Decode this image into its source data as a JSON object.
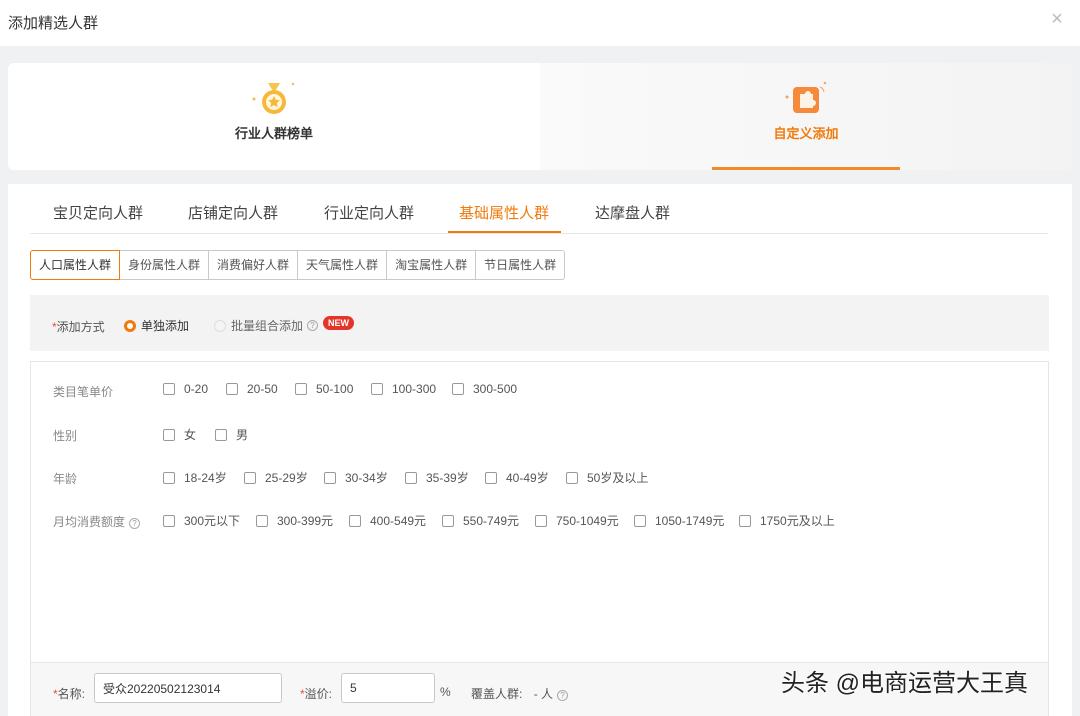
{
  "dialog": {
    "title": "添加精选人群"
  },
  "top_cards": [
    {
      "label": "行业人群榜单",
      "icon": "medal-icon",
      "active": false
    },
    {
      "label": "自定义添加",
      "icon": "puzzle-icon",
      "active": true
    }
  ],
  "main_tabs": [
    "宝贝定向人群",
    "店铺定向人群",
    "行业定向人群",
    "基础属性人群",
    "达摩盘人群"
  ],
  "main_tab_active": "基础属性人群",
  "sub_tabs": [
    "人口属性人群",
    "身份属性人群",
    "消费偏好人群",
    "天气属性人群",
    "淘宝属性人群",
    "节日属性人群"
  ],
  "sub_tab_active": "人口属性人群",
  "add_method": {
    "required_mark": "*",
    "label": "添加方式",
    "options": [
      "单独添加",
      "批量组合添加"
    ],
    "selected": "单独添加",
    "badge": "NEW"
  },
  "filters": [
    {
      "label": "类目笔单价",
      "options": [
        "0-20",
        "20-50",
        "50-100",
        "100-300",
        "300-500"
      ]
    },
    {
      "label": "性别",
      "options": [
        "女",
        "男"
      ]
    },
    {
      "label": "年龄",
      "options": [
        "18-24岁",
        "25-29岁",
        "30-34岁",
        "35-39岁",
        "40-49岁",
        "50岁及以上"
      ]
    },
    {
      "label": "月均消费额度",
      "options": [
        "300元以下",
        "300-399元",
        "400-549元",
        "550-749元",
        "750-1049元",
        "1050-1749元",
        "1750元及以上"
      ]
    }
  ],
  "form": {
    "name_label": "名称:",
    "name_value": "受众20220502123014",
    "premium_label": "溢价:",
    "premium_value": "5",
    "premium_unit": "%",
    "coverage_label": "覆盖人群:",
    "coverage_value": "- 人"
  },
  "watermark": "头条 @电商运营大王真",
  "colors": {
    "accent": "#f07b0c",
    "badge": "#e5352b",
    "required": "#f24b3a"
  }
}
